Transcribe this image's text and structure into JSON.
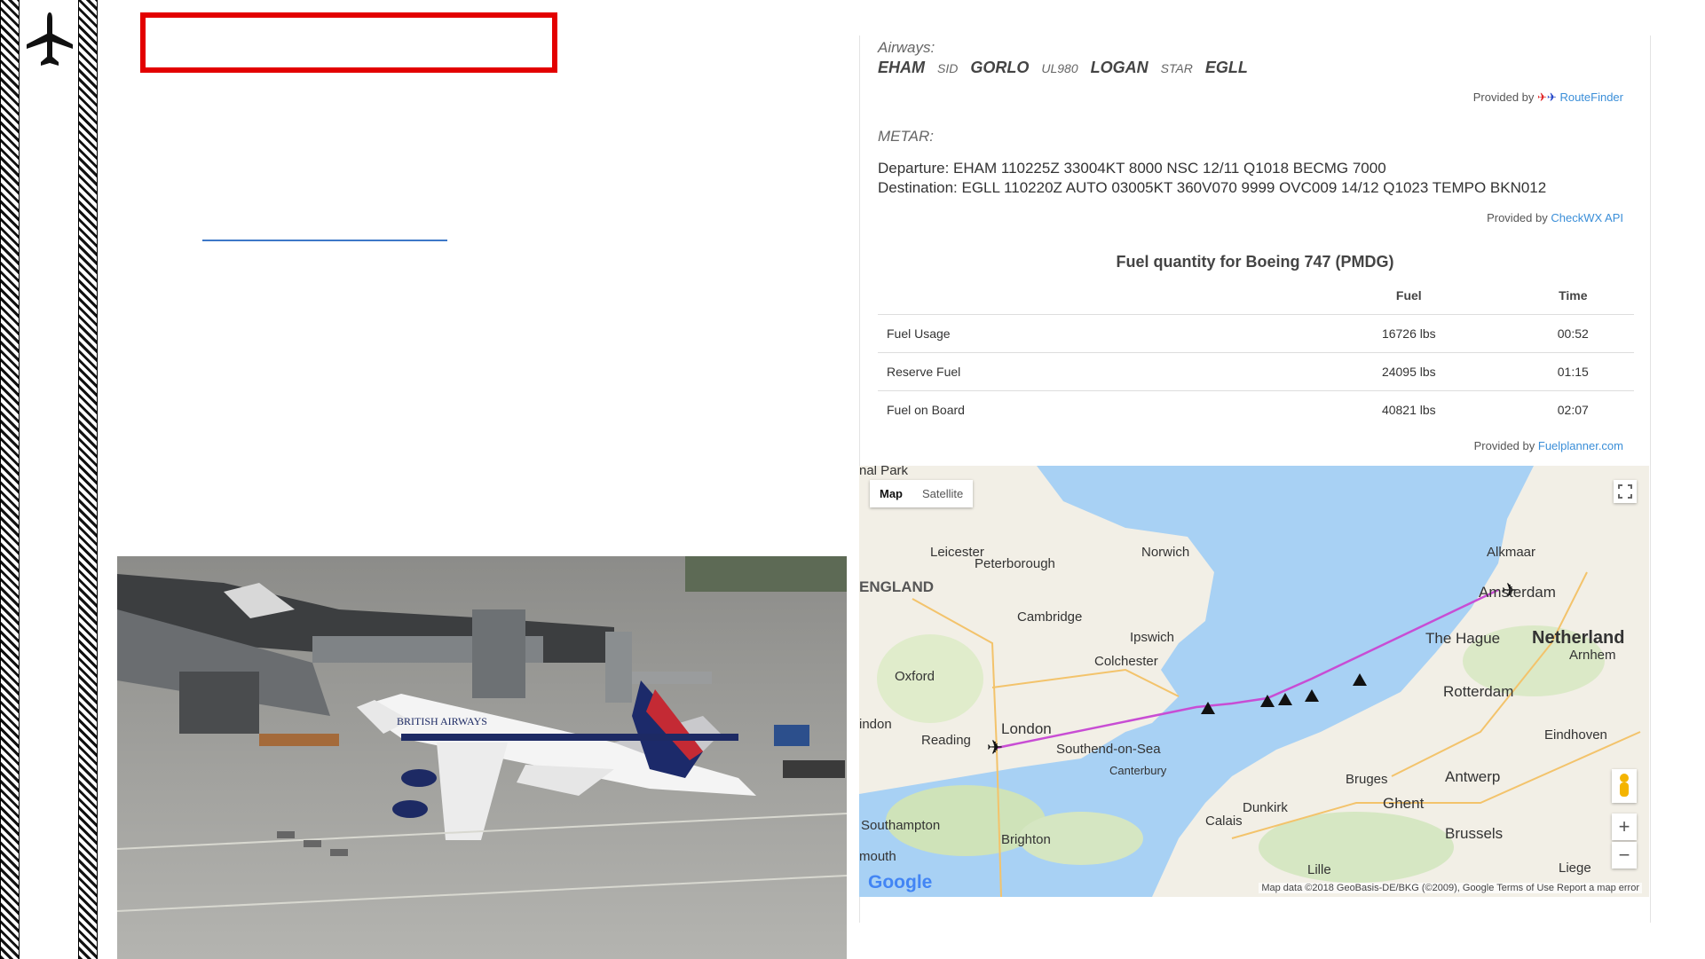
{
  "route": {
    "airways_label": "Airways:",
    "waypoints": [
      {
        "text": "EHAM",
        "kind": "wp"
      },
      {
        "text": "SID",
        "kind": "aw"
      },
      {
        "text": "GORLO",
        "kind": "wp"
      },
      {
        "text": "UL980",
        "kind": "aw"
      },
      {
        "text": "LOGAN",
        "kind": "wp"
      },
      {
        "text": "STAR",
        "kind": "aw"
      },
      {
        "text": "EGLL",
        "kind": "wp"
      }
    ],
    "provided_by": "Provided by",
    "provider": "RouteFinder"
  },
  "metar": {
    "label": "METAR:",
    "departure": "Departure: EHAM 110225Z 33004KT 8000 NSC 12/11 Q1018 BECMG 7000",
    "destination": "Destination: EGLL 110220Z AUTO 03005KT 360V070 9999 OVC009 14/12 Q1023 TEMPO BKN012",
    "provided_by": "Provided by",
    "provider": "CheckWX API"
  },
  "fuel": {
    "title": "Fuel quantity for Boeing 747 (PMDG)",
    "columns": [
      "",
      "Fuel",
      "Time"
    ],
    "rows": [
      {
        "name": "Fuel Usage",
        "fuel": "16726 lbs",
        "time": "00:52"
      },
      {
        "name": "Reserve Fuel",
        "fuel": "24095 lbs",
        "time": "01:15"
      },
      {
        "name": "Fuel on Board",
        "fuel": "40821 lbs",
        "time": "02:07"
      }
    ],
    "provided_by": "Provided by",
    "provider": "Fuelplanner.com"
  },
  "map": {
    "tab_map": "Map",
    "tab_satellite": "Satellite",
    "zoom_in": "+",
    "zoom_out": "−",
    "google": "Google",
    "attribution": "Map data ©2018 GeoBasis-DE/BKG (©2009), Google   Terms of Use   Report a map error",
    "labels": {
      "leicester": "Leicester",
      "peterborough": "Peterborough",
      "norwich": "Norwich",
      "england": "ENGLAND",
      "cambridge": "Cambridge",
      "ipswich": "Ipswich",
      "colchester": "Colchester",
      "oxford": "Oxford",
      "london": "London",
      "reading": "Reading",
      "southend": "Southend-on-Sea",
      "canterbury": "Canterbury",
      "southampton": "Southampton",
      "brighton": "Brighton",
      "calais": "Calais",
      "dunkirk": "Dunkirk",
      "lille": "Lille",
      "bruges": "Bruges",
      "ghent": "Ghent",
      "brussels": "Brussels",
      "antwerp": "Antwerp",
      "rotterdam": "Rotterdam",
      "the_hague": "The Hague",
      "amsterdam": "Amsterdam",
      "alkmaar": "Alkmaar",
      "netherlands": "Netherland",
      "arnhem": "Arnhem",
      "eindhoven": "Eindhoven",
      "liege": "Liege",
      "national_park": "nal Park",
      "london_partial": "indon",
      "portsmouth_partial": "mouth"
    }
  },
  "photo": {
    "airline_text": "BRITISH AIRWAYS"
  },
  "colors": {
    "accent_red": "#e30000",
    "link_blue": "#3a8ed8",
    "route_line": "#c84dd4",
    "sea": "#a8d1f4",
    "land": "#f2efe6"
  }
}
